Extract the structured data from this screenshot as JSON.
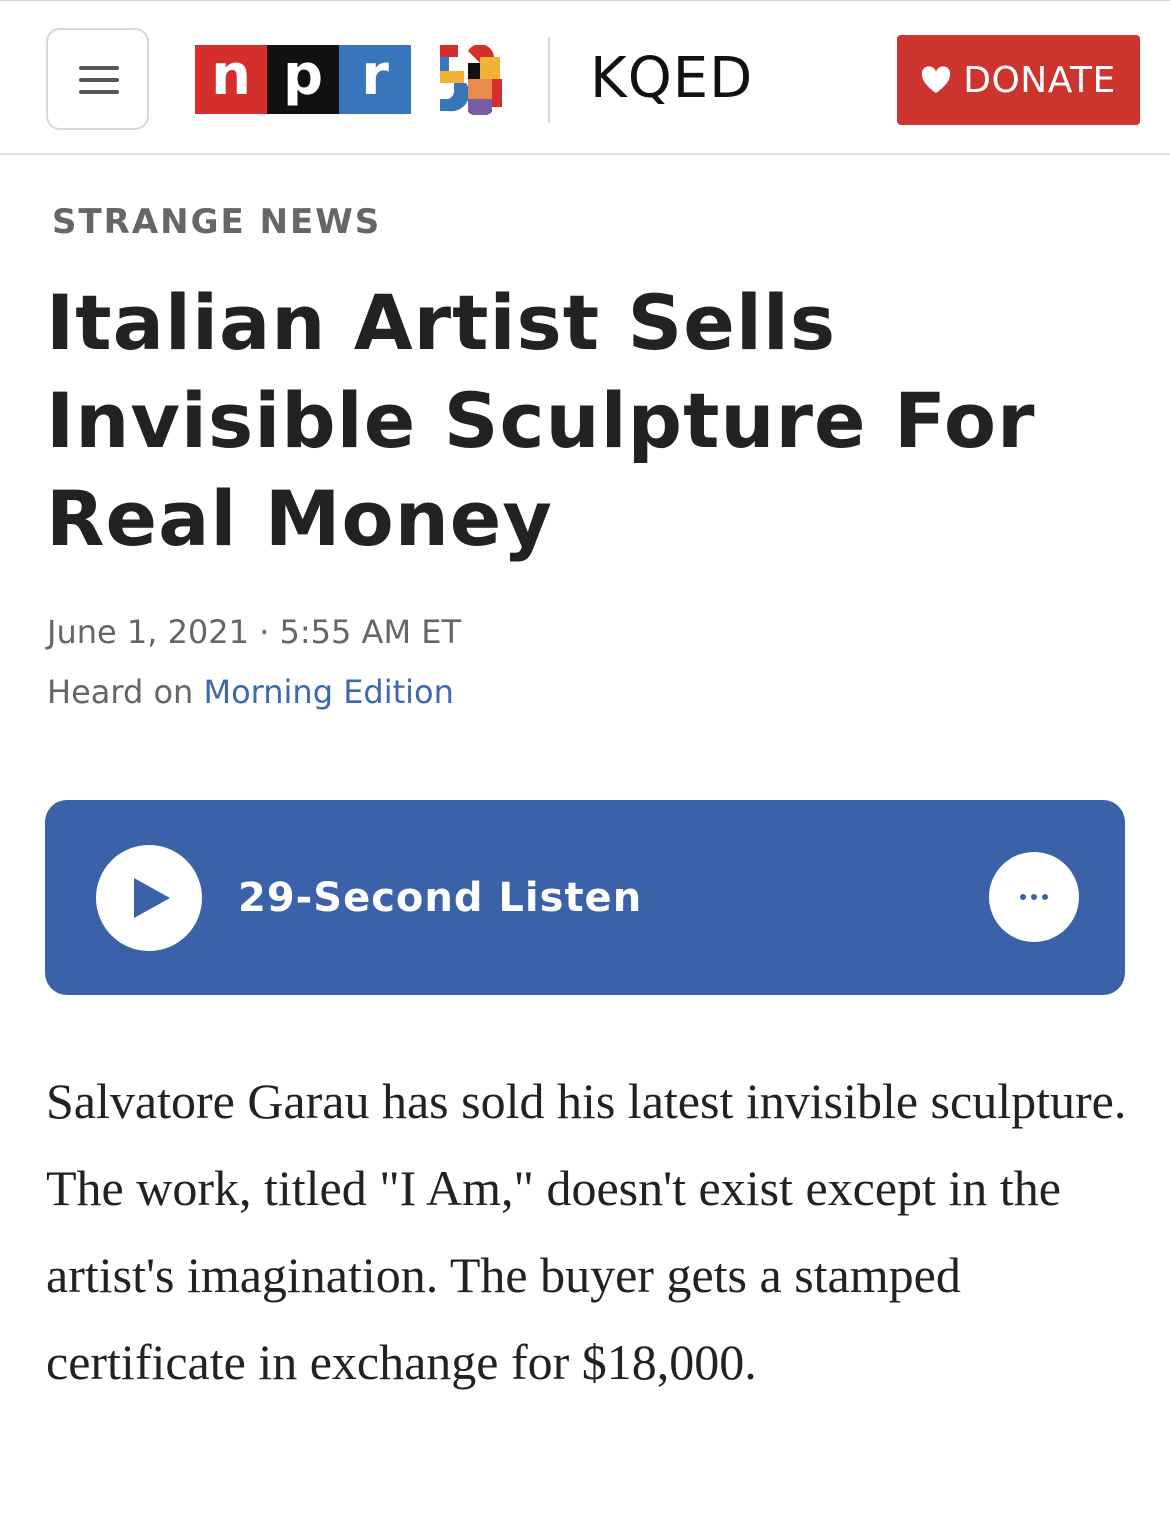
{
  "header": {
    "menu_icon": "hamburger-menu-icon",
    "logo": {
      "letters": [
        "n",
        "p",
        "r"
      ],
      "colors": [
        "#d42f2c",
        "#111111",
        "#3876bc"
      ]
    },
    "anniversary_badge": "50",
    "station": "KQED",
    "donate": {
      "label": "DONATE",
      "icon": "heart-icon",
      "color": "#cd342d"
    }
  },
  "article": {
    "section": "STRANGE NEWS",
    "headline": "Italian Artist Sells Invisible Sculpture For Real Money",
    "date": "June 1, 2021",
    "date_separator": " · ",
    "time": "5:55 AM ET",
    "heard_on_prefix": "Heard on ",
    "show": "Morning Edition",
    "body": "Salvatore Garau has sold his latest invisible sculpture. The work, titled \"I Am,\" doesn't exist except in the artist's imagination. The buyer gets a stamped certificate in exchange for $18,000."
  },
  "player": {
    "title": "29-Second Listen",
    "play_icon": "play-icon",
    "more_icon": "more-options-icon",
    "color": "#3b62a8"
  }
}
